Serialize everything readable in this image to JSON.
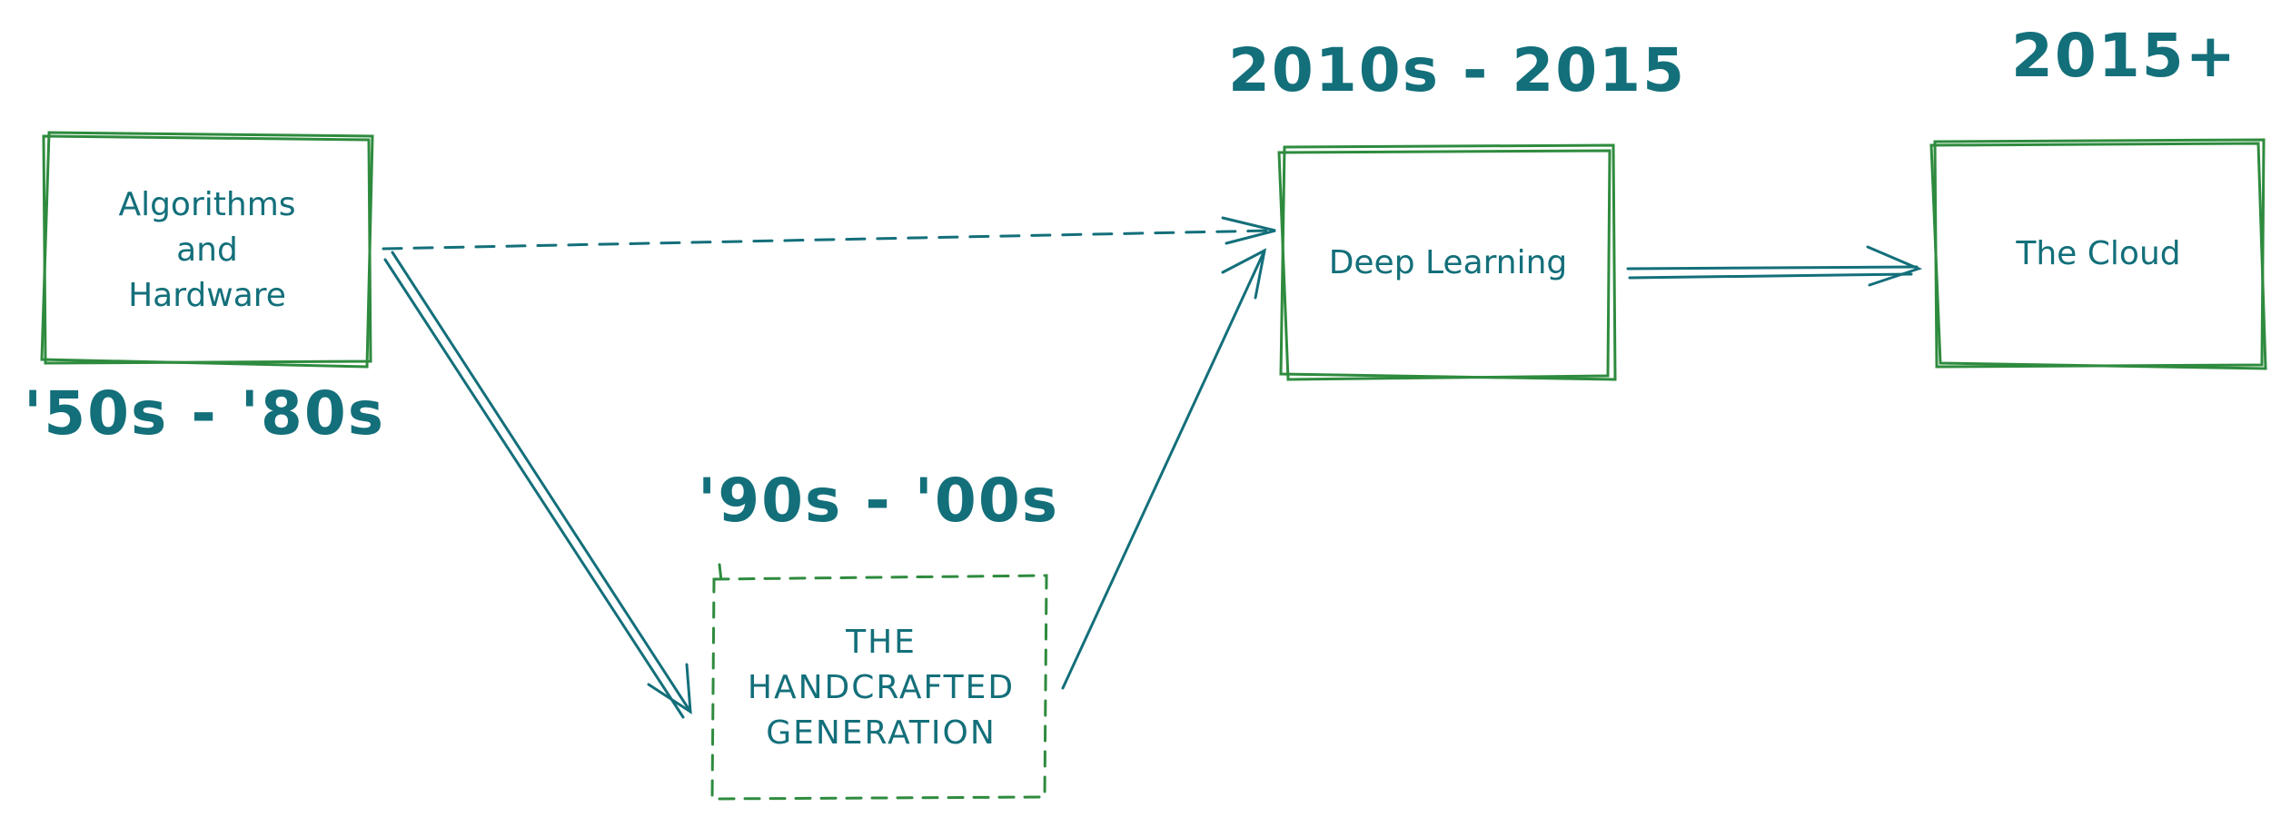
{
  "diagram": {
    "stroke_color": "#2e8b3e",
    "arrow_color": "#136f7a",
    "text_color": "#136f7a",
    "nodes": [
      {
        "id": "algorithms",
        "lines": [
          "Algorithms",
          "and",
          "Hardware"
        ],
        "border": "solid"
      },
      {
        "id": "handcrafted",
        "lines": [
          "THE",
          "HANDCRAFTED",
          "GENERATION"
        ],
        "border": "dashed"
      },
      {
        "id": "deep-learning",
        "lines": [
          "Deep Learning"
        ],
        "border": "solid"
      },
      {
        "id": "cloud",
        "lines": [
          "The Cloud"
        ],
        "border": "solid"
      }
    ],
    "eras": {
      "algorithms": "'50s - '80s",
      "handcrafted": "'90s - '00s",
      "deep_learning": "2010s - 2015",
      "cloud": "2015+"
    },
    "edges": [
      {
        "from": "algorithms",
        "to": "handcrafted",
        "style": "double"
      },
      {
        "from": "algorithms",
        "to": "deep-learning",
        "style": "dashed"
      },
      {
        "from": "handcrafted",
        "to": "deep-learning",
        "style": "solid"
      },
      {
        "from": "deep-learning",
        "to": "cloud",
        "style": "double"
      }
    ]
  }
}
